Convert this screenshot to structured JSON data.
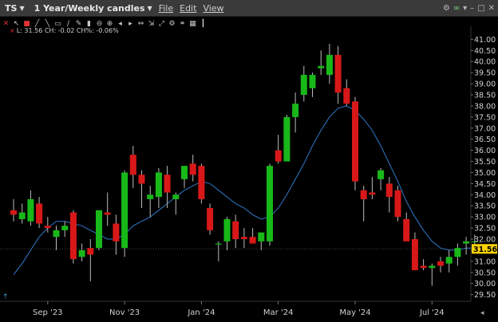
{
  "window": {
    "symbol": "TS",
    "range": "1 Year/Weekly candles",
    "menus": [
      "File",
      "Edit",
      "View"
    ],
    "controls": [
      "gear-icon",
      "link-icon",
      "chevron-down-icon",
      "minimize-icon",
      "maximize-icon",
      "close-icon"
    ]
  },
  "toolbar": {
    "icons": [
      "cross-icon",
      "cursor-icon",
      "square-icon",
      "line-icon",
      "line-icon",
      "rect-icon",
      "slash-icon",
      "pencil-icon",
      "bar-icon",
      "zoom-out-icon",
      "zoom-in-icon",
      "arrow-left-icon",
      "arrow-right-icon",
      "fit-icon",
      "compress-icon",
      "expand-icon",
      "settings-icon",
      "link-icon",
      "grid-icon",
      "candle-icon"
    ]
  },
  "legend": {
    "text": "L: 31.56 CH: -0.02 CH%: -0.06%"
  },
  "price_tag": "31.56",
  "colors": {
    "up": "#18b818",
    "down": "#d81818",
    "ma": "#2e79c9",
    "tag": "#ffd400",
    "grid": "#1a1a1a"
  },
  "chart_data": {
    "type": "candlestick",
    "ylim": [
      29.2,
      41.3
    ],
    "yticks": [
      "29.50",
      "30.00",
      "30.50",
      "31.00",
      "31.50",
      "32.00",
      "32.50",
      "33.00",
      "33.50",
      "34.00",
      "34.50",
      "35.00",
      "35.50",
      "36.00",
      "36.50",
      "37.00",
      "37.50",
      "38.00",
      "38.50",
      "39.00",
      "39.50",
      "40.00",
      "40.50",
      "41.00"
    ],
    "xticks": [
      {
        "label": "Sep '23",
        "index": 4
      },
      {
        "label": "Nov '23",
        "index": 13
      },
      {
        "label": "Jan '24",
        "index": 22
      },
      {
        "label": "Mar '24",
        "index": 31
      },
      {
        "label": "May '24",
        "index": 40
      },
      {
        "label": "Jul '24",
        "index": 49
      }
    ],
    "candles": [
      {
        "o": 33.3,
        "h": 33.8,
        "l": 32.8,
        "c": 33.1
      },
      {
        "o": 32.9,
        "h": 33.6,
        "l": 32.7,
        "c": 33.2
      },
      {
        "o": 32.8,
        "h": 34.2,
        "l": 32.6,
        "c": 33.8
      },
      {
        "o": 33.6,
        "h": 33.9,
        "l": 32.5,
        "c": 32.7
      },
      {
        "o": 32.6,
        "h": 33.0,
        "l": 32.3,
        "c": 32.5
      },
      {
        "o": 32.1,
        "h": 32.6,
        "l": 31.5,
        "c": 32.4
      },
      {
        "o": 32.4,
        "h": 32.8,
        "l": 32.1,
        "c": 32.6
      },
      {
        "o": 33.2,
        "h": 33.3,
        "l": 30.9,
        "c": 31.1
      },
      {
        "o": 31.2,
        "h": 31.8,
        "l": 31.0,
        "c": 31.5
      },
      {
        "o": 31.6,
        "h": 32.0,
        "l": 30.1,
        "c": 31.3
      },
      {
        "o": 31.6,
        "h": 33.3,
        "l": 31.5,
        "c": 33.3
      },
      {
        "o": 33.2,
        "h": 34.1,
        "l": 32.6,
        "c": 33.1
      },
      {
        "o": 32.7,
        "h": 33.1,
        "l": 31.3,
        "c": 31.9
      },
      {
        "o": 31.6,
        "h": 35.1,
        "l": 31.2,
        "c": 35.0
      },
      {
        "o": 35.8,
        "h": 36.2,
        "l": 34.3,
        "c": 34.9
      },
      {
        "o": 34.9,
        "h": 35.1,
        "l": 33.4,
        "c": 34.5
      },
      {
        "o": 33.8,
        "h": 34.4,
        "l": 33.0,
        "c": 34.0
      },
      {
        "o": 33.9,
        "h": 35.2,
        "l": 33.4,
        "c": 35.0
      },
      {
        "o": 34.9,
        "h": 35.3,
        "l": 33.4,
        "c": 34.1
      },
      {
        "o": 33.8,
        "h": 34.1,
        "l": 33.1,
        "c": 34.0
      },
      {
        "o": 34.7,
        "h": 35.3,
        "l": 34.3,
        "c": 35.3
      },
      {
        "o": 35.4,
        "h": 35.8,
        "l": 34.6,
        "c": 34.9
      },
      {
        "o": 35.3,
        "h": 35.4,
        "l": 33.6,
        "c": 33.8
      },
      {
        "o": 33.4,
        "h": 33.6,
        "l": 32.2,
        "c": 32.4
      },
      {
        "o": 31.8,
        "h": 31.9,
        "l": 31.0,
        "c": 31.8
      },
      {
        "o": 31.9,
        "h": 33.0,
        "l": 31.5,
        "c": 32.9
      },
      {
        "o": 32.8,
        "h": 33.1,
        "l": 31.6,
        "c": 32.0
      },
      {
        "o": 32.1,
        "h": 32.5,
        "l": 31.6,
        "c": 32.0
      },
      {
        "o": 32.1,
        "h": 32.5,
        "l": 31.8,
        "c": 31.8
      },
      {
        "o": 31.9,
        "h": 32.3,
        "l": 31.5,
        "c": 32.3
      },
      {
        "o": 31.9,
        "h": 35.4,
        "l": 31.7,
        "c": 35.3
      },
      {
        "o": 36.0,
        "h": 36.7,
        "l": 35.4,
        "c": 35.5
      },
      {
        "o": 35.5,
        "h": 37.6,
        "l": 35.5,
        "c": 37.5
      },
      {
        "o": 37.5,
        "h": 38.6,
        "l": 36.8,
        "c": 38.1
      },
      {
        "o": 38.5,
        "h": 39.8,
        "l": 38.2,
        "c": 39.4
      },
      {
        "o": 38.8,
        "h": 39.5,
        "l": 38.4,
        "c": 39.4
      },
      {
        "o": 39.7,
        "h": 40.5,
        "l": 39.4,
        "c": 39.8
      },
      {
        "o": 39.4,
        "h": 40.8,
        "l": 39.0,
        "c": 40.3
      },
      {
        "o": 40.3,
        "h": 40.7,
        "l": 38.1,
        "c": 38.6
      },
      {
        "o": 38.8,
        "h": 39.2,
        "l": 38.0,
        "c": 38.1
      },
      {
        "o": 38.2,
        "h": 38.4,
        "l": 34.2,
        "c": 34.6
      },
      {
        "o": 34.2,
        "h": 34.4,
        "l": 32.8,
        "c": 33.8
      },
      {
        "o": 34.1,
        "h": 34.8,
        "l": 33.8,
        "c": 34.0
      },
      {
        "o": 34.7,
        "h": 35.2,
        "l": 34.2,
        "c": 35.1
      },
      {
        "o": 34.5,
        "h": 34.8,
        "l": 33.2,
        "c": 33.9
      },
      {
        "o": 34.2,
        "h": 34.4,
        "l": 32.8,
        "c": 33.0
      },
      {
        "o": 32.9,
        "h": 33.2,
        "l": 31.9,
        "c": 31.9
      },
      {
        "o": 32.0,
        "h": 32.3,
        "l": 30.6,
        "c": 30.6
      },
      {
        "o": 30.8,
        "h": 31.1,
        "l": 30.6,
        "c": 30.7
      },
      {
        "o": 30.7,
        "h": 30.9,
        "l": 29.9,
        "c": 30.8
      },
      {
        "o": 31.0,
        "h": 31.2,
        "l": 30.5,
        "c": 30.8
      },
      {
        "o": 30.9,
        "h": 31.5,
        "l": 30.5,
        "c": 31.2
      },
      {
        "o": 31.2,
        "h": 31.8,
        "l": 30.8,
        "c": 31.6
      },
      {
        "o": 31.8,
        "h": 32.1,
        "l": 31.3,
        "c": 31.9
      },
      {
        "o": 31.9,
        "h": 32.2,
        "l": 31.4,
        "c": 31.9
      }
    ],
    "ma_name": "",
    "ma_values": [
      30.4,
      30.9,
      31.5,
      32.1,
      32.5,
      32.8,
      32.8,
      32.7,
      32.6,
      32.4,
      32.2,
      32.0,
      32.0,
      32.2,
      32.6,
      32.8,
      33.0,
      33.3,
      33.6,
      33.9,
      34.2,
      34.4,
      34.6,
      34.5,
      34.2,
      33.9,
      33.6,
      33.4,
      33.1,
      32.9,
      33.0,
      33.4,
      34.0,
      34.7,
      35.4,
      36.2,
      36.9,
      37.5,
      37.9,
      38.0,
      37.8,
      37.4,
      36.9,
      36.2,
      35.4,
      34.6,
      33.7,
      33.0,
      32.4,
      31.9,
      31.6,
      31.5,
      31.5,
      31.6,
      31.6
    ],
    "last_price": 31.56
  }
}
